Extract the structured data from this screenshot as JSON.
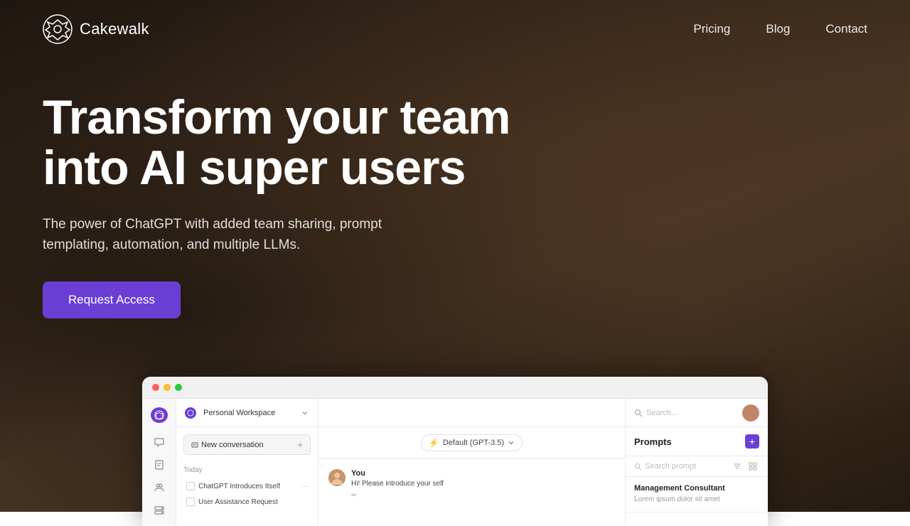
{
  "nav": {
    "logo_text": "Cakewalk",
    "links": [
      {
        "label": "Pricing",
        "href": "#pricing"
      },
      {
        "label": "Blog",
        "href": "#blog"
      },
      {
        "label": "Contact",
        "href": "#contact"
      }
    ]
  },
  "hero": {
    "title_line1": "Transform your team",
    "title_line2": "into AI super users",
    "subtitle": "The power of ChatGPT with added team sharing, prompt templating, automation, and multiple LLMs.",
    "cta_label": "Request Access"
  },
  "app_preview": {
    "workspace": "Personal Workspace",
    "search_placeholder": "Search...",
    "new_conversation_label": "New conversation",
    "model_selector_label": "Default (GPT-3.5)",
    "conv_date": "Today",
    "conversations": [
      {
        "title": "ChatGPT Introduces Itself"
      },
      {
        "title": "User Assistance Request"
      }
    ],
    "message": {
      "sender": "You",
      "text": "Hi! Please introduce your self"
    },
    "prompts": {
      "title": "Prompts",
      "search_placeholder": "Search prompt",
      "items": [
        {
          "title": "Management Consultant",
          "preview": "Lorem ipsum dolor sit amet"
        }
      ]
    }
  }
}
